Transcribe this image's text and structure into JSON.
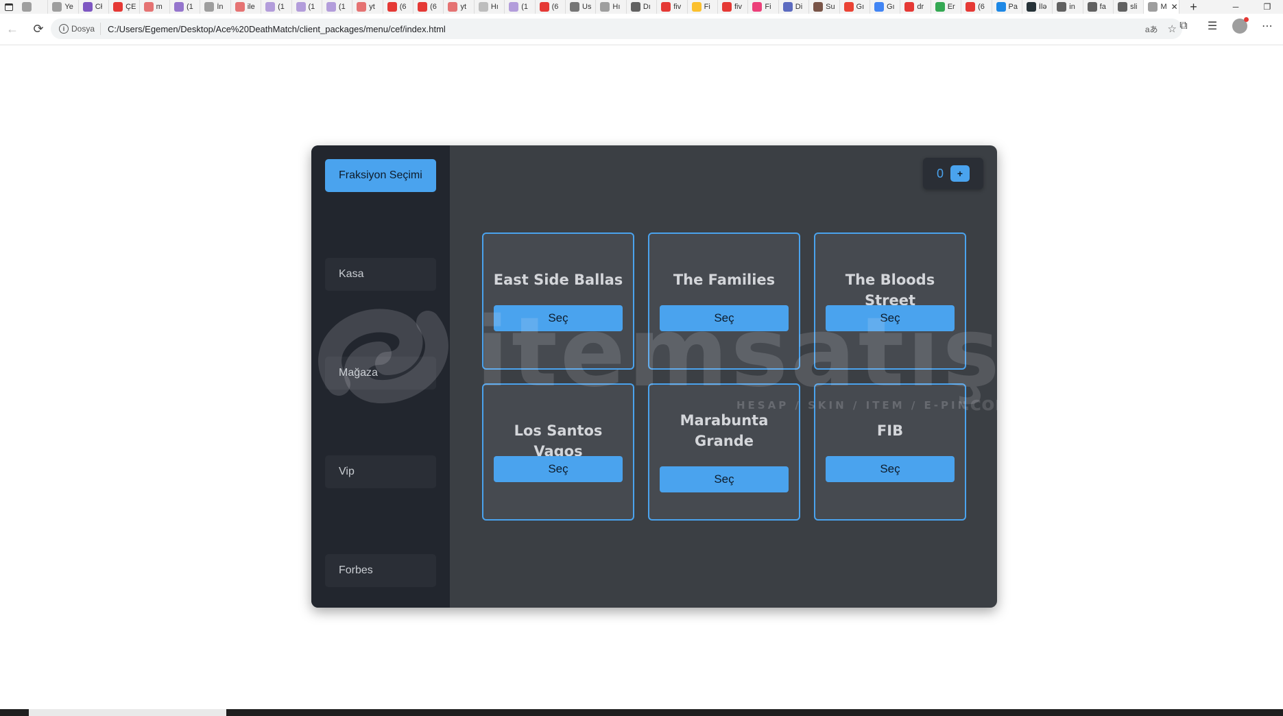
{
  "browser": {
    "tabs": [
      {
        "label": "",
        "color": "#9e9e9e"
      },
      {
        "label": "Ye",
        "color": "#9e9e9e"
      },
      {
        "label": "Cł",
        "color": "#7e57c2"
      },
      {
        "label": "ÇE",
        "color": "#e53935"
      },
      {
        "label": "m",
        "color": "#e57373"
      },
      {
        "label": "(1",
        "color": "#9575cd"
      },
      {
        "label": "İn",
        "color": "#9e9e9e"
      },
      {
        "label": "ile",
        "color": "#e57373"
      },
      {
        "label": "(1",
        "color": "#b39ddb"
      },
      {
        "label": "(1",
        "color": "#b39ddb"
      },
      {
        "label": "(1",
        "color": "#b39ddb"
      },
      {
        "label": "yt",
        "color": "#e57373"
      },
      {
        "label": "(6",
        "color": "#e53935"
      },
      {
        "label": "(6",
        "color": "#e53935"
      },
      {
        "label": "yt",
        "color": "#e57373"
      },
      {
        "label": "Hı",
        "color": "#bdbdbd"
      },
      {
        "label": "(1",
        "color": "#b39ddb"
      },
      {
        "label": "(6",
        "color": "#e53935"
      },
      {
        "label": "Us",
        "color": "#757575"
      },
      {
        "label": "Hı",
        "color": "#9e9e9e"
      },
      {
        "label": "Dı",
        "color": "#616161"
      },
      {
        "label": "fiv",
        "color": "#e53935"
      },
      {
        "label": "Fi",
        "color": "#fbc02d"
      },
      {
        "label": "fiv",
        "color": "#e53935"
      },
      {
        "label": "Fi",
        "color": "#ec407a"
      },
      {
        "label": "Di",
        "color": "#5c6bc0"
      },
      {
        "label": "Su",
        "color": "#795548"
      },
      {
        "label": "Gı",
        "color": "#ea4335"
      },
      {
        "label": "Gı",
        "color": "#4285f4"
      },
      {
        "label": "dr",
        "color": "#e53935"
      },
      {
        "label": "Er",
        "color": "#34a853"
      },
      {
        "label": "(6",
        "color": "#e53935"
      },
      {
        "label": "Pa",
        "color": "#1e88e5"
      },
      {
        "label": "İlə",
        "color": "#263238"
      },
      {
        "label": "in",
        "color": "#616161"
      },
      {
        "label": "fa",
        "color": "#616161"
      },
      {
        "label": "sli",
        "color": "#616161"
      }
    ],
    "active_tab": {
      "label": "M",
      "color": "#9e9e9e"
    },
    "site_label": "Dosya",
    "url": "C:/Users/Egemen/Desktop/Ace%20DeathMatch/client_packages/menu/cef/index.html"
  },
  "sidebar": {
    "items": [
      {
        "label": "Fraksiyon Seçimi",
        "active": true
      },
      {
        "label": "Kasa",
        "active": false
      },
      {
        "label": "Mağaza",
        "active": false
      },
      {
        "label": "Vip",
        "active": false
      },
      {
        "label": "Forbes",
        "active": false
      }
    ]
  },
  "balance": {
    "value": "0",
    "add_label": "+"
  },
  "factions": [
    {
      "name": "East Side Ballas",
      "button": "Seç"
    },
    {
      "name": "The Families",
      "button": "Seç"
    },
    {
      "name": "The Bloods Street",
      "button": "Seç"
    },
    {
      "name": "Los Santos Vagos",
      "button": "Seç"
    },
    {
      "name": "Marabunta Grande",
      "button": "Seç"
    },
    {
      "name": "FIB",
      "button": "Seç"
    }
  ],
  "watermark": {
    "brand": "itemsatış",
    "tagline": "HESAP / SKIN / ITEM / E-PIN",
    "suffix": ".com"
  },
  "colors": {
    "accent": "#4aa3ee",
    "panel": "#3b3f44",
    "sidebar": "#22262e",
    "card": "#464a50"
  }
}
